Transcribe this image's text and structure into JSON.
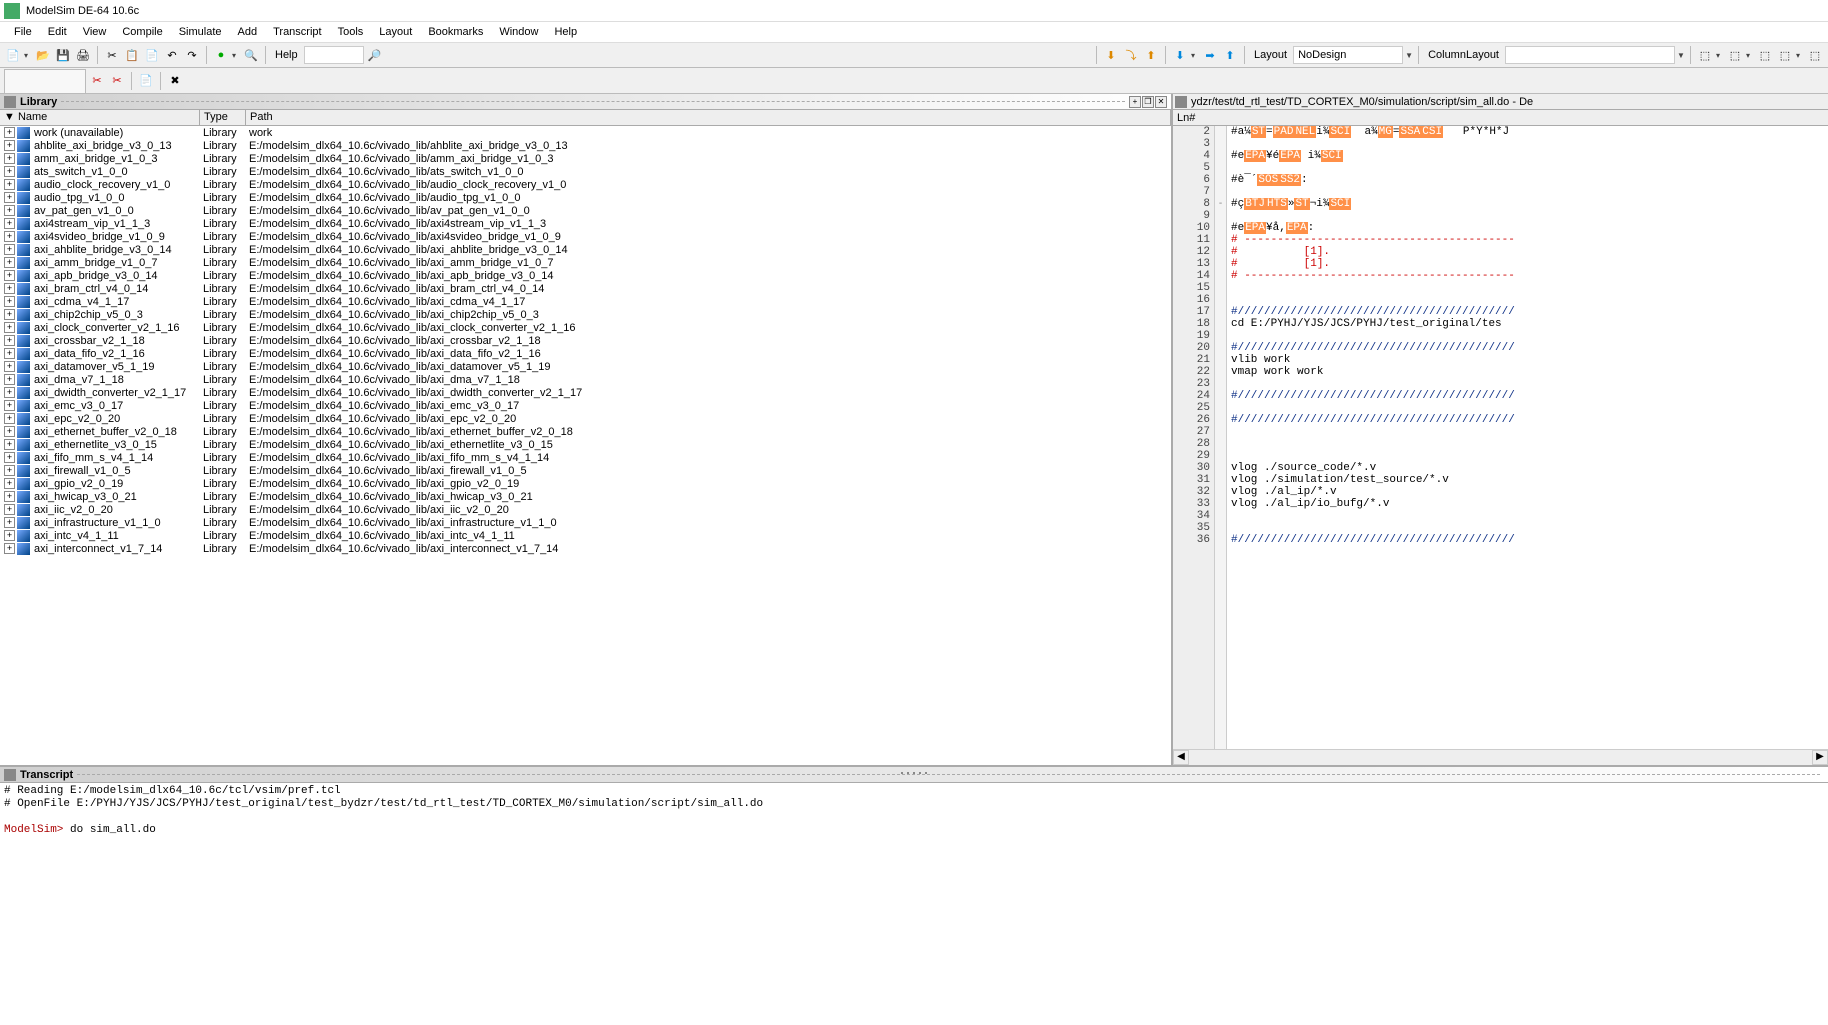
{
  "app_title": "ModelSim DE-64 10.6c",
  "menus": [
    "File",
    "Edit",
    "View",
    "Compile",
    "Simulate",
    "Add",
    "Transcript",
    "Tools",
    "Layout",
    "Bookmarks",
    "Window",
    "Help"
  ],
  "toolbar": {
    "help_label": "Help",
    "layout_label": "Layout",
    "layout_value": "NoDesign",
    "collayout_label": "ColumnLayout",
    "collayout_value": ""
  },
  "library_panel": {
    "title": "Library",
    "col_name": "Name",
    "col_type": "Type",
    "col_path": "Path",
    "filter_icon": "▼"
  },
  "libraries": [
    {
      "name": "work  (unavailable)",
      "type": "Library",
      "path": "work"
    },
    {
      "name": "ahblite_axi_bridge_v3_0_13",
      "type": "Library",
      "path": "E:/modelsim_dlx64_10.6c/vivado_lib/ahblite_axi_bridge_v3_0_13"
    },
    {
      "name": "amm_axi_bridge_v1_0_3",
      "type": "Library",
      "path": "E:/modelsim_dlx64_10.6c/vivado_lib/amm_axi_bridge_v1_0_3"
    },
    {
      "name": "ats_switch_v1_0_0",
      "type": "Library",
      "path": "E:/modelsim_dlx64_10.6c/vivado_lib/ats_switch_v1_0_0"
    },
    {
      "name": "audio_clock_recovery_v1_0",
      "type": "Library",
      "path": "E:/modelsim_dlx64_10.6c/vivado_lib/audio_clock_recovery_v1_0"
    },
    {
      "name": "audio_tpg_v1_0_0",
      "type": "Library",
      "path": "E:/modelsim_dlx64_10.6c/vivado_lib/audio_tpg_v1_0_0"
    },
    {
      "name": "av_pat_gen_v1_0_0",
      "type": "Library",
      "path": "E:/modelsim_dlx64_10.6c/vivado_lib/av_pat_gen_v1_0_0"
    },
    {
      "name": "axi4stream_vip_v1_1_3",
      "type": "Library",
      "path": "E:/modelsim_dlx64_10.6c/vivado_lib/axi4stream_vip_v1_1_3"
    },
    {
      "name": "axi4svideo_bridge_v1_0_9",
      "type": "Library",
      "path": "E:/modelsim_dlx64_10.6c/vivado_lib/axi4svideo_bridge_v1_0_9"
    },
    {
      "name": "axi_ahblite_bridge_v3_0_14",
      "type": "Library",
      "path": "E:/modelsim_dlx64_10.6c/vivado_lib/axi_ahblite_bridge_v3_0_14"
    },
    {
      "name": "axi_amm_bridge_v1_0_7",
      "type": "Library",
      "path": "E:/modelsim_dlx64_10.6c/vivado_lib/axi_amm_bridge_v1_0_7"
    },
    {
      "name": "axi_apb_bridge_v3_0_14",
      "type": "Library",
      "path": "E:/modelsim_dlx64_10.6c/vivado_lib/axi_apb_bridge_v3_0_14"
    },
    {
      "name": "axi_bram_ctrl_v4_0_14",
      "type": "Library",
      "path": "E:/modelsim_dlx64_10.6c/vivado_lib/axi_bram_ctrl_v4_0_14"
    },
    {
      "name": "axi_cdma_v4_1_17",
      "type": "Library",
      "path": "E:/modelsim_dlx64_10.6c/vivado_lib/axi_cdma_v4_1_17"
    },
    {
      "name": "axi_chip2chip_v5_0_3",
      "type": "Library",
      "path": "E:/modelsim_dlx64_10.6c/vivado_lib/axi_chip2chip_v5_0_3"
    },
    {
      "name": "axi_clock_converter_v2_1_16",
      "type": "Library",
      "path": "E:/modelsim_dlx64_10.6c/vivado_lib/axi_clock_converter_v2_1_16"
    },
    {
      "name": "axi_crossbar_v2_1_18",
      "type": "Library",
      "path": "E:/modelsim_dlx64_10.6c/vivado_lib/axi_crossbar_v2_1_18"
    },
    {
      "name": "axi_data_fifo_v2_1_16",
      "type": "Library",
      "path": "E:/modelsim_dlx64_10.6c/vivado_lib/axi_data_fifo_v2_1_16"
    },
    {
      "name": "axi_datamover_v5_1_19",
      "type": "Library",
      "path": "E:/modelsim_dlx64_10.6c/vivado_lib/axi_datamover_v5_1_19"
    },
    {
      "name": "axi_dma_v7_1_18",
      "type": "Library",
      "path": "E:/modelsim_dlx64_10.6c/vivado_lib/axi_dma_v7_1_18"
    },
    {
      "name": "axi_dwidth_converter_v2_1_17",
      "type": "Library",
      "path": "E:/modelsim_dlx64_10.6c/vivado_lib/axi_dwidth_converter_v2_1_17"
    },
    {
      "name": "axi_emc_v3_0_17",
      "type": "Library",
      "path": "E:/modelsim_dlx64_10.6c/vivado_lib/axi_emc_v3_0_17"
    },
    {
      "name": "axi_epc_v2_0_20",
      "type": "Library",
      "path": "E:/modelsim_dlx64_10.6c/vivado_lib/axi_epc_v2_0_20"
    },
    {
      "name": "axi_ethernet_buffer_v2_0_18",
      "type": "Library",
      "path": "E:/modelsim_dlx64_10.6c/vivado_lib/axi_ethernet_buffer_v2_0_18"
    },
    {
      "name": "axi_ethernetlite_v3_0_15",
      "type": "Library",
      "path": "E:/modelsim_dlx64_10.6c/vivado_lib/axi_ethernetlite_v3_0_15"
    },
    {
      "name": "axi_fifo_mm_s_v4_1_14",
      "type": "Library",
      "path": "E:/modelsim_dlx64_10.6c/vivado_lib/axi_fifo_mm_s_v4_1_14"
    },
    {
      "name": "axi_firewall_v1_0_5",
      "type": "Library",
      "path": "E:/modelsim_dlx64_10.6c/vivado_lib/axi_firewall_v1_0_5"
    },
    {
      "name": "axi_gpio_v2_0_19",
      "type": "Library",
      "path": "E:/modelsim_dlx64_10.6c/vivado_lib/axi_gpio_v2_0_19"
    },
    {
      "name": "axi_hwicap_v3_0_21",
      "type": "Library",
      "path": "E:/modelsim_dlx64_10.6c/vivado_lib/axi_hwicap_v3_0_21"
    },
    {
      "name": "axi_iic_v2_0_20",
      "type": "Library",
      "path": "E:/modelsim_dlx64_10.6c/vivado_lib/axi_iic_v2_0_20"
    },
    {
      "name": "axi_infrastructure_v1_1_0",
      "type": "Library",
      "path": "E:/modelsim_dlx64_10.6c/vivado_lib/axi_infrastructure_v1_1_0"
    },
    {
      "name": "axi_intc_v4_1_11",
      "type": "Library",
      "path": "E:/modelsim_dlx64_10.6c/vivado_lib/axi_intc_v4_1_11"
    },
    {
      "name": "axi_interconnect_v1_7_14",
      "type": "Library",
      "path": "E:/modelsim_dlx64_10.6c/vivado_lib/axi_interconnect_v1_7_14"
    }
  ],
  "editor": {
    "tab_title": "ydzr/test/td_rtl_test/TD_CORTEX_M0/simulation/script/sim_all.do - De",
    "ln_label": "Ln#",
    "lines": [
      {
        "n": 2,
        "raw": "#a¼<hl>ST</hl>=<hl>PAD</hl><hl>NEL</hl>i¾<hl>SCI</hl>  a¾<hl>MG</hl>=<hl>SSA</hl><hl>CSI</hl>   P*Y*H*J"
      },
      {
        "n": 3,
        "raw": ""
      },
      {
        "n": 4,
        "raw": "#e<hl>EPA</hl>¥é<hl>EPA</hl> i¾<hl>SCI</hl>"
      },
      {
        "n": 5,
        "raw": ""
      },
      {
        "n": 6,
        "raw": "#è¯´<hl>SOS</hl><hl>SS2</hl>:"
      },
      {
        "n": 7,
        "raw": ""
      },
      {
        "n": 8,
        "raw": "#ç<hl>BTJ</hl><hl>HTS</hl>»<hl>ST</hl>¬i¾<hl>SCI</hl>",
        "fold": "-"
      },
      {
        "n": 9,
        "raw": ""
      },
      {
        "n": 10,
        "raw": "#e<hl>EPA</hl>¥å,<hl>EPA</hl>:"
      },
      {
        "n": 11,
        "raw": "<span class='red'># -----------------------------------------</span>"
      },
      {
        "n": 12,
        "raw": "<span class='red'>#          [1].</span>"
      },
      {
        "n": 13,
        "raw": "<span class='red'>#          [1].</span>"
      },
      {
        "n": 14,
        "raw": "<span class='red'># -----------------------------------------</span>"
      },
      {
        "n": 15,
        "raw": ""
      },
      {
        "n": 16,
        "raw": ""
      },
      {
        "n": 17,
        "raw": "<span class='cmt'>#//////////////////////////////////////////</span>"
      },
      {
        "n": 18,
        "raw": "cd E:/PYHJ/YJS/JCS/PYHJ/test_original/tes"
      },
      {
        "n": 19,
        "raw": ""
      },
      {
        "n": 20,
        "raw": "<span class='cmt'>#//////////////////////////////////////////</span>"
      },
      {
        "n": 21,
        "raw": "vlib work"
      },
      {
        "n": 22,
        "raw": "vmap work work"
      },
      {
        "n": 23,
        "raw": ""
      },
      {
        "n": 24,
        "raw": "<span class='cmt'>#//////////////////////////////////////////</span>"
      },
      {
        "n": 25,
        "raw": ""
      },
      {
        "n": 26,
        "raw": "<span class='cmt'>#//////////////////////////////////////////</span>"
      },
      {
        "n": 27,
        "raw": ""
      },
      {
        "n": 28,
        "raw": ""
      },
      {
        "n": 29,
        "raw": ""
      },
      {
        "n": 30,
        "raw": "vlog ./source_code/*.v"
      },
      {
        "n": 31,
        "raw": "vlog ./simulation/test_source/*.v"
      },
      {
        "n": 32,
        "raw": "vlog ./al_ip/*.v"
      },
      {
        "n": 33,
        "raw": "vlog ./al_ip/io_bufg/*.v"
      },
      {
        "n": 34,
        "raw": ""
      },
      {
        "n": 35,
        "raw": ""
      },
      {
        "n": 36,
        "raw": "<span class='cmt'>#//////////////////////////////////////////</span>"
      }
    ]
  },
  "transcript": {
    "title": "Transcript",
    "lines": [
      "# Reading E:/modelsim_dlx64_10.6c/tcl/vsim/pref.tcl",
      "# OpenFile E:/PYHJ/YJS/JCS/PYHJ/test_original/test_bydzr/test/td_rtl_test/TD_CORTEX_M0/simulation/script/sim_all.do"
    ],
    "prompt": "ModelSim>",
    "command": "do sim_all.do"
  }
}
